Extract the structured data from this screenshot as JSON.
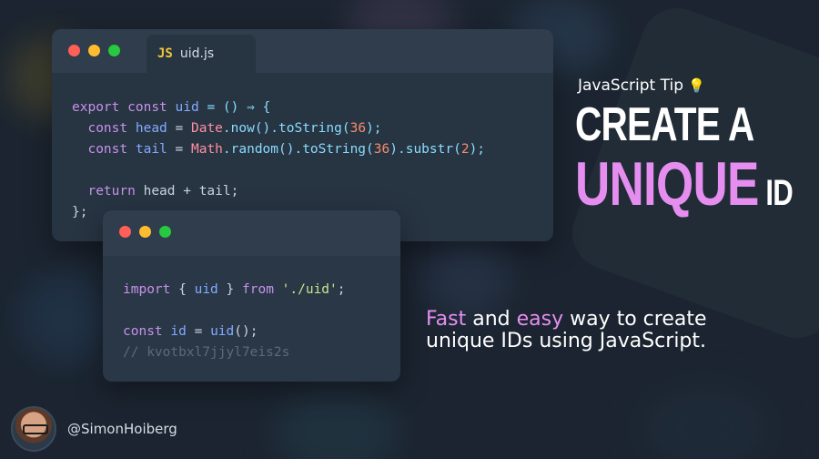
{
  "colors": {
    "accent_pink": "#e58ef0",
    "background": "#1b2430"
  },
  "editor1": {
    "tab_badge": "JS",
    "filename": "uid.js",
    "code": {
      "l1_export": "export",
      "l1_const": "const",
      "l1_uid": "uid",
      "l1_rest": " = () ⇒ {",
      "l2_const": "const",
      "l2_head": "head",
      "l2_eq": " = ",
      "l2_date": "Date",
      "l2_now": ".now().toString(",
      "l2_36": "36",
      "l2_end": ");",
      "l3_const": "const",
      "l3_tail": "tail",
      "l3_eq": " = ",
      "l3_math": "Math",
      "l3_random": ".random().toString(",
      "l3_36": "36",
      "l3_substr": ").substr(",
      "l3_2": "2",
      "l3_end": ");",
      "l5_return": "return",
      "l5_expr": " head + tail;",
      "l6": "};"
    }
  },
  "editor2": {
    "code": {
      "l1_import": "import",
      "l1_mid": " { ",
      "l1_uid": "uid",
      "l1_close": " } ",
      "l1_from": "from",
      "l1_str": "'./uid'",
      "l1_end": ";",
      "l3_const": "const",
      "l3_id": "id",
      "l3_eq": " = ",
      "l3_uid": "uid",
      "l3_end": "();",
      "l4_comment": "// kvotbxl7jjyl7eis2s"
    }
  },
  "tip": {
    "label": "JavaScript Tip",
    "bulb_icon": "💡",
    "line1": "CREATE A",
    "line2_highlight": "UNIQUE",
    "line2_rest": "ID"
  },
  "description": {
    "word1": "Fast",
    "and": " and ",
    "word2": "easy",
    "rest": " way to create unique IDs using JavaScript."
  },
  "author": {
    "handle": "@SimonHoiberg"
  }
}
